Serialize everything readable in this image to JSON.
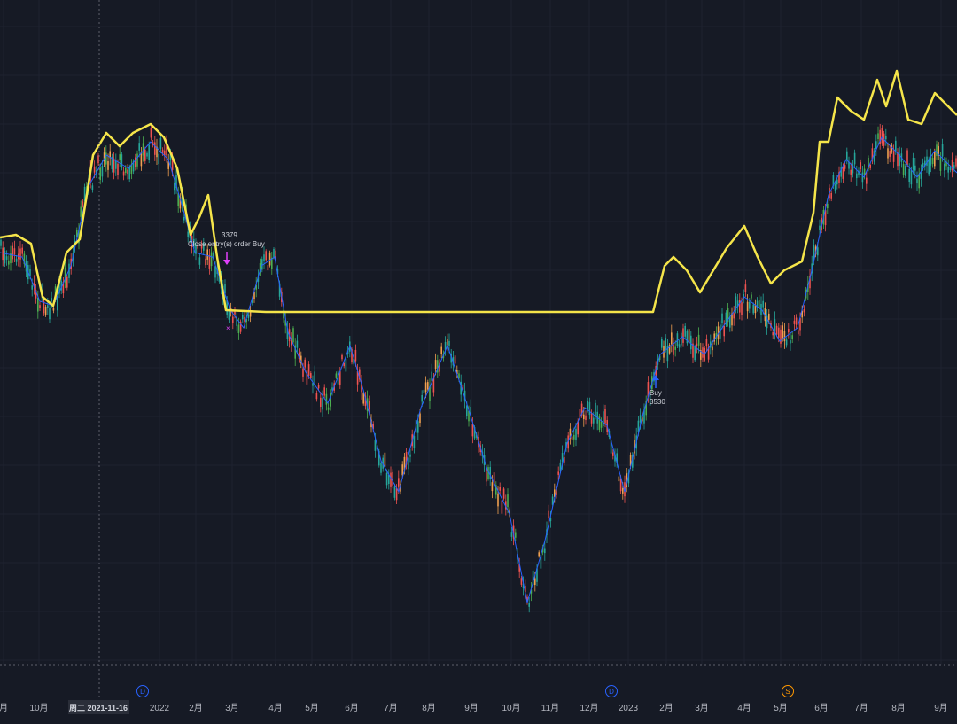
{
  "chart_data": {
    "type": "line",
    "description_visible": "candlestick price chart with equity line overlay",
    "x_axis": {
      "tick_labels": [
        "月",
        "10月",
        "2022",
        "2月",
        "3月",
        "4月",
        "5月",
        "6月",
        "7月",
        "8月",
        "9月",
        "10月",
        "11月",
        "12月",
        "2023",
        "2月",
        "3月",
        "4月",
        "5月",
        "6月",
        "7月",
        "8月",
        "9月"
      ],
      "crosshair_label": "周二 2021-11-16"
    },
    "y_axis": {
      "visible": false
    },
    "series": [
      {
        "color": "#f5e54a",
        "points": [
          [
            0,
            268
          ],
          [
            18,
            265
          ],
          [
            35,
            275
          ],
          [
            48,
            335
          ],
          [
            60,
            345
          ],
          [
            75,
            285
          ],
          [
            90,
            270
          ],
          [
            105,
            175
          ],
          [
            120,
            150
          ],
          [
            135,
            165
          ],
          [
            150,
            150
          ],
          [
            170,
            140
          ],
          [
            185,
            155
          ],
          [
            200,
            190
          ],
          [
            215,
            265
          ],
          [
            225,
            245
          ],
          [
            235,
            220
          ],
          [
            245,
            290
          ],
          [
            255,
            350
          ],
          [
            300,
            352
          ],
          [
            400,
            352
          ],
          [
            500,
            352
          ],
          [
            600,
            352
          ],
          [
            700,
            352
          ],
          [
            737,
            352
          ],
          [
            750,
            300
          ],
          [
            760,
            290
          ],
          [
            775,
            305
          ],
          [
            790,
            330
          ],
          [
            805,
            305
          ],
          [
            820,
            280
          ],
          [
            840,
            255
          ],
          [
            855,
            290
          ],
          [
            870,
            320
          ],
          [
            885,
            305
          ],
          [
            905,
            295
          ],
          [
            918,
            240
          ],
          [
            925,
            160
          ],
          [
            935,
            160
          ],
          [
            945,
            110
          ],
          [
            960,
            125
          ],
          [
            975,
            135
          ],
          [
            990,
            90
          ],
          [
            1000,
            120
          ],
          [
            1012,
            80
          ],
          [
            1025,
            135
          ],
          [
            1040,
            140
          ],
          [
            1055,
            105
          ],
          [
            1070,
            120
          ],
          [
            1080,
            130
          ]
        ]
      },
      {
        "color": "#2962ff",
        "points": [
          [
            0,
            285
          ],
          [
            25,
            290
          ],
          [
            45,
            340
          ],
          [
            60,
            345
          ],
          [
            80,
            300
          ],
          [
            100,
            210
          ],
          [
            120,
            175
          ],
          [
            145,
            190
          ],
          [
            170,
            160
          ],
          [
            190,
            180
          ],
          [
            205,
            230
          ],
          [
            220,
            285
          ],
          [
            240,
            290
          ],
          [
            260,
            350
          ],
          [
            275,
            370
          ],
          [
            295,
            300
          ],
          [
            310,
            290
          ],
          [
            325,
            375
          ],
          [
            345,
            420
          ],
          [
            370,
            455
          ],
          [
            395,
            390
          ],
          [
            410,
            440
          ],
          [
            430,
            520
          ],
          [
            450,
            555
          ],
          [
            475,
            460
          ],
          [
            505,
            390
          ],
          [
            525,
            450
          ],
          [
            550,
            530
          ],
          [
            575,
            580
          ],
          [
            595,
            680
          ],
          [
            615,
            610
          ],
          [
            640,
            500
          ],
          [
            660,
            460
          ],
          [
            685,
            480
          ],
          [
            705,
            555
          ],
          [
            725,
            470
          ],
          [
            745,
            400
          ],
          [
            770,
            380
          ],
          [
            795,
            400
          ],
          [
            815,
            370
          ],
          [
            840,
            335
          ],
          [
            860,
            350
          ],
          [
            880,
            385
          ],
          [
            900,
            370
          ],
          [
            915,
            310
          ],
          [
            935,
            220
          ],
          [
            955,
            180
          ],
          [
            975,
            200
          ],
          [
            995,
            155
          ],
          [
            1015,
            175
          ],
          [
            1035,
            200
          ],
          [
            1055,
            170
          ],
          [
            1080,
            195
          ]
        ]
      }
    ],
    "trades": [
      {
        "label": "Close entry(s) order Buy",
        "value": "3379"
      },
      {
        "label": "Buy",
        "value": "3530"
      }
    ],
    "event_badges": [
      "D",
      "D",
      "S"
    ],
    "colors": {
      "background": "#161a25",
      "equity_line": "#f5e54a",
      "ma_line": "#2962ff",
      "candle_up": "#26a69a",
      "candle_down": "#ef5350",
      "exit_marker": "#e040fb",
      "entry_marker": "#2962ff",
      "badge_dividend": "#2962ff",
      "badge_split": "#ff9800"
    }
  }
}
